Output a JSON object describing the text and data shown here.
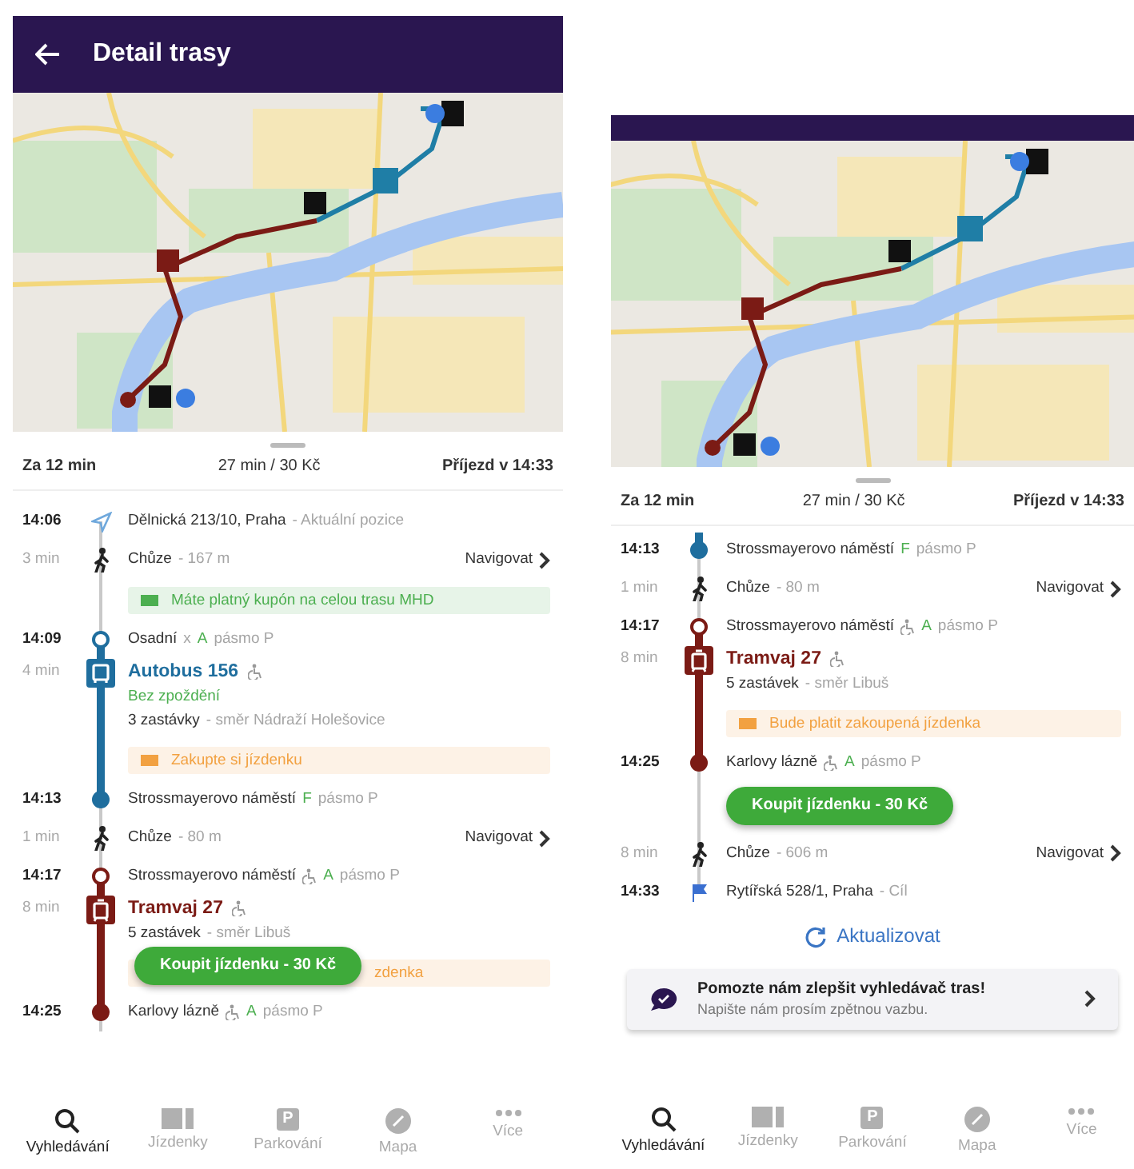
{
  "screens": [
    {
      "header": {
        "title": "Detail trasy"
      },
      "summary": {
        "departure": "Za 12 min",
        "duration_price": "27 min / 30 Kč",
        "arrival": "Příjezd v 14:33"
      },
      "timeline": [
        {
          "kind": "origin",
          "time": "14:06",
          "name": "Dělnická 213/10, Praha",
          "accessible": false,
          "details": [
            {
              "text": "- Aktuální pozice",
              "color": "#a5a5a5"
            }
          ]
        },
        {
          "kind": "walk",
          "duration": "3 min",
          "label": "Chůze",
          "distance": "- 167 m",
          "action": "Navigovat"
        },
        {
          "kind": "notice",
          "color": "#4caf50",
          "text": "Máte platný kupón na celou trasu MHD",
          "covered": false
        },
        {
          "kind": "boarding",
          "time": "14:09",
          "color": "#1f6e9e",
          "name": "Osadní",
          "accessible": false,
          "details": [
            {
              "text": "x",
              "color": "#a5a5a5"
            },
            {
              "text": "A",
              "color": "#4caf50"
            },
            {
              "text": "pásmo P",
              "color": "#a5a5a5"
            }
          ]
        },
        {
          "kind": "bus",
          "duration": "4 min",
          "line": "Autobus 156",
          "accessible": true,
          "status": "Bez zpoždění",
          "stops": "3 zastávky",
          "direction": "- směr Nádraží Holešovice"
        },
        {
          "kind": "notice",
          "color": "#f2a141",
          "text": "Zakupte si jízdenku",
          "covered": false
        },
        {
          "kind": "alighting",
          "time": "14:13",
          "color": "#1f6e9e",
          "name": "Strossmayerovo náměstí",
          "accessible": false,
          "details": [
            {
              "text": "F",
              "color": "#4caf50"
            },
            {
              "text": "pásmo P",
              "color": "#a5a5a5"
            }
          ]
        },
        {
          "kind": "walk",
          "duration": "1 min",
          "label": "Chůze",
          "distance": "- 80 m",
          "action": "Navigovat"
        },
        {
          "kind": "boarding",
          "time": "14:17",
          "color": "#7b1b15",
          "name": "Strossmayerovo náměstí",
          "accessible": true,
          "details": [
            {
              "text": "A",
              "color": "#4caf50"
            },
            {
              "text": "pásmo P",
              "color": "#a5a5a5"
            }
          ]
        },
        {
          "kind": "tram",
          "duration": "8 min",
          "line": "Tramvaj 27",
          "accessible": true,
          "stops": "5 zastávek",
          "direction": "- směr Libuš"
        },
        {
          "kind": "notice",
          "color": "#f2a141",
          "text": "zdenka",
          "covered": true
        },
        {
          "kind": "alighting",
          "time": "14:25",
          "color": "#7b1b15",
          "name": "Karlovy lázně",
          "accessible": true,
          "details": [
            {
              "text": "A",
              "color": "#4caf50"
            },
            {
              "text": "pásmo P",
              "color": "#a5a5a5"
            }
          ]
        }
      ],
      "floating_button": "Koupit jízdenku - 30 Kč",
      "nav": [
        {
          "label": "Vyhledávání",
          "selected": true
        },
        {
          "label": "Jízdenky",
          "selected": false
        },
        {
          "label": "Parkování",
          "selected": false,
          "icon_text": "P"
        },
        {
          "label": "Mapa",
          "selected": false
        },
        {
          "label": "Více",
          "selected": false
        }
      ]
    },
    {
      "summary": {
        "departure": "Za 12 min",
        "duration_price": "27 min / 30 Kč",
        "arrival": "Příjezd v 14:33"
      },
      "timeline": [
        {
          "kind": "alighting",
          "time": "14:13",
          "color": "#1f6e9e",
          "name": "Strossmayerovo náměstí",
          "accessible": false,
          "details": [
            {
              "text": "F",
              "color": "#4caf50"
            },
            {
              "text": "pásmo P",
              "color": "#a5a5a5"
            }
          ]
        },
        {
          "kind": "walk",
          "duration": "1 min",
          "label": "Chůze",
          "distance": "- 80 m",
          "action": "Navigovat"
        },
        {
          "kind": "boarding",
          "time": "14:17",
          "color": "#7b1b15",
          "name": "Strossmayerovo náměstí",
          "accessible": true,
          "details": [
            {
              "text": "A",
              "color": "#4caf50"
            },
            {
              "text": "pásmo P",
              "color": "#a5a5a5"
            }
          ]
        },
        {
          "kind": "tram",
          "duration": "8 min",
          "line": "Tramvaj 27",
          "accessible": true,
          "stops": "5 zastávek",
          "direction": "- směr Libuš"
        },
        {
          "kind": "notice",
          "color": "#f2a141",
          "text": "Bude platit zakoupená jízdenka",
          "covered": false
        },
        {
          "kind": "alighting",
          "time": "14:25",
          "color": "#7b1b15",
          "name": "Karlovy lázně",
          "accessible": true,
          "details": [
            {
              "text": "A",
              "color": "#4caf50"
            },
            {
              "text": "pásmo P",
              "color": "#a5a5a5"
            }
          ]
        },
        {
          "kind": "button",
          "label": "Koupit jízdenku - 30 Kč"
        },
        {
          "kind": "walk",
          "duration": "8 min",
          "label": "Chůze",
          "distance": "- 606 m",
          "action": "Navigovat"
        },
        {
          "kind": "destination",
          "time": "14:33",
          "name": "Rytířská 528/1, Praha",
          "accessible": false,
          "details": [
            {
              "text": "- Cíl",
              "color": "#a5a5a5"
            }
          ]
        }
      ],
      "refresh": "Aktualizovat",
      "feedback": {
        "title": "Pomozte nám zlepšit vyhledávač tras!",
        "subtitle": "Napište nám prosím zpětnou vazbu."
      },
      "nav": [
        {
          "label": "Vyhledávání",
          "selected": true
        },
        {
          "label": "Jízdenky",
          "selected": false
        },
        {
          "label": "Parkování",
          "selected": false,
          "icon_text": "P"
        },
        {
          "label": "Mapa",
          "selected": false
        },
        {
          "label": "Více",
          "selected": false
        }
      ]
    }
  ]
}
